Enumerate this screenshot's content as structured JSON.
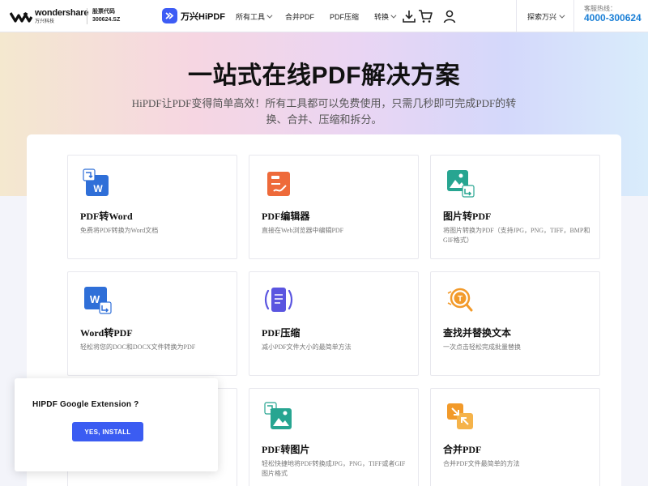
{
  "header": {
    "brand_name": "wondershare",
    "brand_sub": "万兴科技",
    "stock_label": "股票代码",
    "stock_code": "300624.SZ",
    "product_name": "万兴HiPDF",
    "nav": [
      {
        "label": "所有工具",
        "dropdown": true
      },
      {
        "label": "合并PDF",
        "dropdown": false
      },
      {
        "label": "PDF压缩",
        "dropdown": false
      },
      {
        "label": "转换",
        "dropdown": true
      }
    ],
    "icons": [
      "download-icon",
      "cart-icon",
      "user-icon"
    ],
    "explore_label": "探索万兴",
    "hotline_label": "客服热线：",
    "hotline_number": "4000-300624"
  },
  "hero": {
    "title": "一站式在线PDF解决方案",
    "subtitle": "HiPDF让PDF变得简单高效！所有工具都可以免费使用，只需几秒即可完成PDF的转换、合并、压缩和拆分。"
  },
  "tools": [
    {
      "icon": "pdf-to-word-icon",
      "title": "PDF转Word",
      "desc": "免费将PDF转换为Word文档"
    },
    {
      "icon": "pdf-editor-icon",
      "title": "PDF编辑器",
      "desc": "直接在Web浏览器中编辑PDF"
    },
    {
      "icon": "image-to-pdf-icon",
      "title": "图片转PDF",
      "desc": "将图片转换为PDF（支持JPG，PNG，TIFF，BMP和GIF格式）"
    },
    {
      "icon": "word-to-pdf-icon",
      "title": "Word转PDF",
      "desc": "轻松将您的DOC和DOCX文件转换为PDF"
    },
    {
      "icon": "pdf-compress-icon",
      "title": "PDF压缩",
      "desc": "减小PDF文件大小的最简单方法"
    },
    {
      "icon": "find-replace-icon",
      "title": "查找并替换文本",
      "desc": "一次点击轻松完成批量替换"
    },
    {
      "icon": "",
      "title": "",
      "desc": ""
    },
    {
      "icon": "pdf-to-image-icon",
      "title": "PDF转图片",
      "desc": "轻松快捷地将PDF转换成JPG，PNG，TIFF或者GIF图片格式"
    },
    {
      "icon": "merge-pdf-icon",
      "title": "合并PDF",
      "desc": "合并PDF文件最简单的方法"
    }
  ],
  "popup": {
    "title": "HIPDF Google Extension ?",
    "button_label": "YES, INSTALL"
  },
  "colors": {
    "primary_blue": "#3b5cf2",
    "hotline_blue": "#1a7fd6",
    "word_blue": "#2f6fd8",
    "editor_orange": "#ee6a3a",
    "image_green": "#27a591",
    "compress_purple": "#5a55e0",
    "find_orange": "#f29a2a"
  }
}
